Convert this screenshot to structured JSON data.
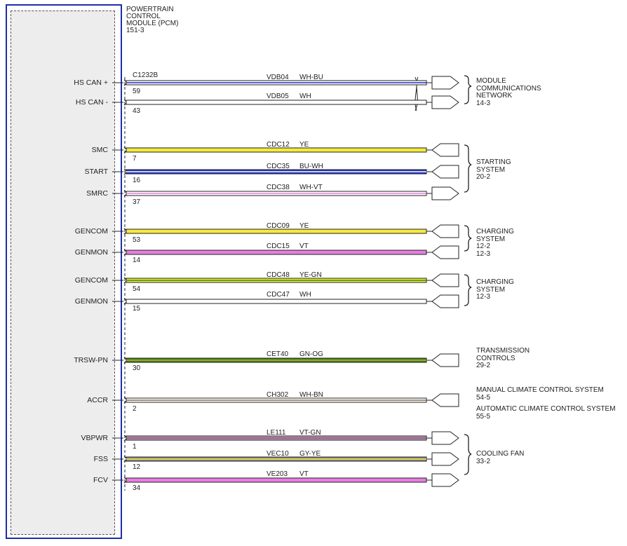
{
  "module": {
    "lines": [
      "POWERTRAIN",
      "CONTROL",
      "MODULE (PCM)",
      "151-3"
    ],
    "connector": "C1232B"
  },
  "pins": [
    {
      "name": "HS CAN +",
      "num": "59",
      "wire": "VDB04",
      "color": "WH-BU"
    },
    {
      "name": "HS CAN -",
      "num": "43",
      "wire": "VDB05",
      "color": "WH"
    },
    {
      "name": "SMC",
      "num": "7",
      "wire": "CDC12",
      "color": "YE"
    },
    {
      "name": "START",
      "num": "16",
      "wire": "CDC35",
      "color": "BU-WH"
    },
    {
      "name": "SMRC",
      "num": "37",
      "wire": "CDC38",
      "color": "WH-VT"
    },
    {
      "name": "GENCOM",
      "num": "53",
      "wire": "CDC09",
      "color": "YE"
    },
    {
      "name": "GENMON",
      "num": "14",
      "wire": "CDC15",
      "color": "VT"
    },
    {
      "name": "GENCOM",
      "num": "54",
      "wire": "CDC48",
      "color": "YE-GN"
    },
    {
      "name": "GENMON",
      "num": "15",
      "wire": "CDC47",
      "color": "WH"
    },
    {
      "name": "TRSW-PN",
      "num": "30",
      "wire": "CET40",
      "color": "GN-OG"
    },
    {
      "name": "ACCR",
      "num": "2",
      "wire": "CH302",
      "color": "WH-BN"
    },
    {
      "name": "VBPWR",
      "num": "1",
      "wire": "LE111",
      "color": "VT-GN"
    },
    {
      "name": "FSS",
      "num": "12",
      "wire": "VEC10",
      "color": "GY-YE"
    },
    {
      "name": "FCV",
      "num": "34",
      "wire": "VE203",
      "color": "VT"
    }
  ],
  "destinations": [
    {
      "lines": [
        "MODULE",
        "COMMUNICATIONS",
        "NETWORK",
        "14-3"
      ]
    },
    {
      "lines": [
        "STARTING",
        "SYSTEM",
        "20-2"
      ]
    },
    {
      "lines": [
        "CHARGING",
        "SYSTEM",
        "12-2",
        "12-3"
      ]
    },
    {
      "lines": [
        "CHARGING",
        "SYSTEM",
        "12-3"
      ]
    },
    {
      "lines": [
        "TRANSMISSION",
        "CONTROLS",
        "29-2"
      ]
    },
    {
      "lines": [
        "MANUAL CLIMATE CONTROL SYSTEM",
        "54-5"
      ]
    },
    {
      "lines": [
        "AUTOMATIC CLIMATE CONTROL SYSTEM",
        "55-5"
      ]
    },
    {
      "lines": [
        "COOLING FAN",
        "33-2"
      ]
    }
  ],
  "wire_colors": {
    "WH": "#ffffff",
    "YE": "#f4ea3c",
    "BU": "#2133c9",
    "VT": "#e67fe0",
    "GN": "#2e8b1e",
    "OG": "#e8962a",
    "BN": "#8b6a4a",
    "GY": "#8a8a8a"
  }
}
